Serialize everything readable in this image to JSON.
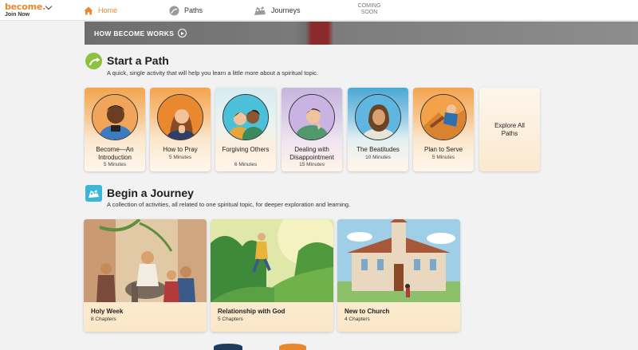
{
  "brand": {
    "logo": "become.",
    "join": "Join Now"
  },
  "nav": {
    "home": "Home",
    "paths": "Paths",
    "journeys": "Journeys",
    "coming_soon": "COMING SOON"
  },
  "banner": {
    "label": "HOW BECOME WORKS"
  },
  "paths_section": {
    "title": "Start a Path",
    "subtitle": "A quick, single activity that will help you learn a little more about a spiritual topic.",
    "cards": [
      {
        "title": "Become—An Introduction",
        "duration": "5 Minutes"
      },
      {
        "title": "How to Pray",
        "duration": "5 Minutes"
      },
      {
        "title": "Forgiving Others",
        "duration": "6 Minutes"
      },
      {
        "title": "Dealing with Disappointment",
        "duration": "15 Minutes"
      },
      {
        "title": "The Beatitudes",
        "duration": "10 Minutes"
      },
      {
        "title": "Plan to Serve",
        "duration": "5 Minutes"
      }
    ],
    "explore": "Explore All Paths"
  },
  "journeys_section": {
    "title": "Begin a Journey",
    "subtitle": "A collection of activities, all related to one spiritual topic, for deeper exploration and learning.",
    "cards": [
      {
        "title": "Holy Week",
        "chapters": "8 Chapters"
      },
      {
        "title": "Relationship with God",
        "chapters": "5 Chapters"
      },
      {
        "title": "New to Church",
        "chapters": "4 Chapters"
      }
    ]
  },
  "colors": {
    "accent": "#e8872c",
    "journey_icon": "#3cb6d8",
    "path_icon": "#8fc13e"
  }
}
